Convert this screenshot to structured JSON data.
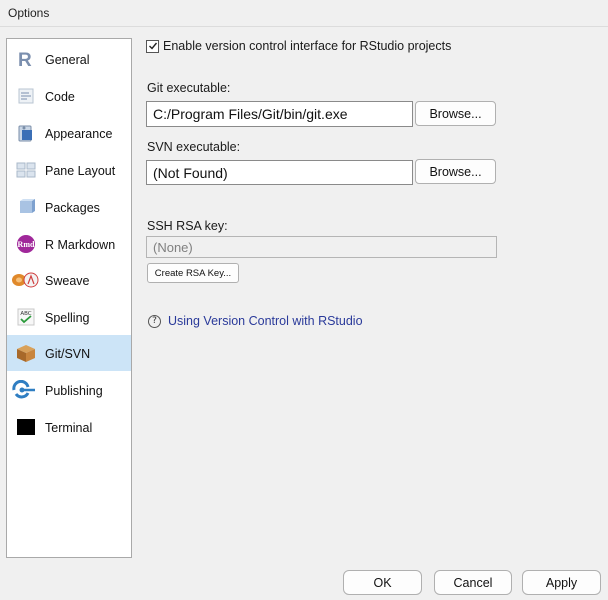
{
  "window": {
    "title": "Options"
  },
  "sidebar": {
    "items": [
      {
        "label": "General",
        "icon": "r-logo-icon"
      },
      {
        "label": "Code",
        "icon": "code-icon"
      },
      {
        "label": "Appearance",
        "icon": "appearance-icon"
      },
      {
        "label": "Pane Layout",
        "icon": "pane-layout-icon"
      },
      {
        "label": "Packages",
        "icon": "packages-icon"
      },
      {
        "label": "R Markdown",
        "icon": "rmarkdown-icon"
      },
      {
        "label": "Sweave",
        "icon": "sweave-icon"
      },
      {
        "label": "Spelling",
        "icon": "spelling-icon"
      },
      {
        "label": "Git/SVN",
        "icon": "git-box-icon"
      },
      {
        "label": "Publishing",
        "icon": "publishing-icon"
      },
      {
        "label": "Terminal",
        "icon": "terminal-icon"
      }
    ],
    "selected": "Git/SVN"
  },
  "git": {
    "enable_label": "Enable version control interface for RStudio projects",
    "enable_checked": true,
    "git_exe_label": "Git executable:",
    "git_exe_value": "C:/Program Files/Git/bin/git.exe",
    "svn_exe_label": "SVN executable:",
    "svn_exe_value": "(Not Found)",
    "browse_label": "Browse...",
    "ssh_label": "SSH RSA key:",
    "ssh_value": "(None)",
    "create_key_label": "Create RSA Key...",
    "help_link": "Using Version Control with RStudio",
    "help_icon_glyph": "?"
  },
  "footer": {
    "ok": "OK",
    "cancel": "Cancel",
    "apply": "Apply"
  },
  "colors": {
    "selected_bg": "#cce4f7",
    "link": "#2a3a9a"
  }
}
